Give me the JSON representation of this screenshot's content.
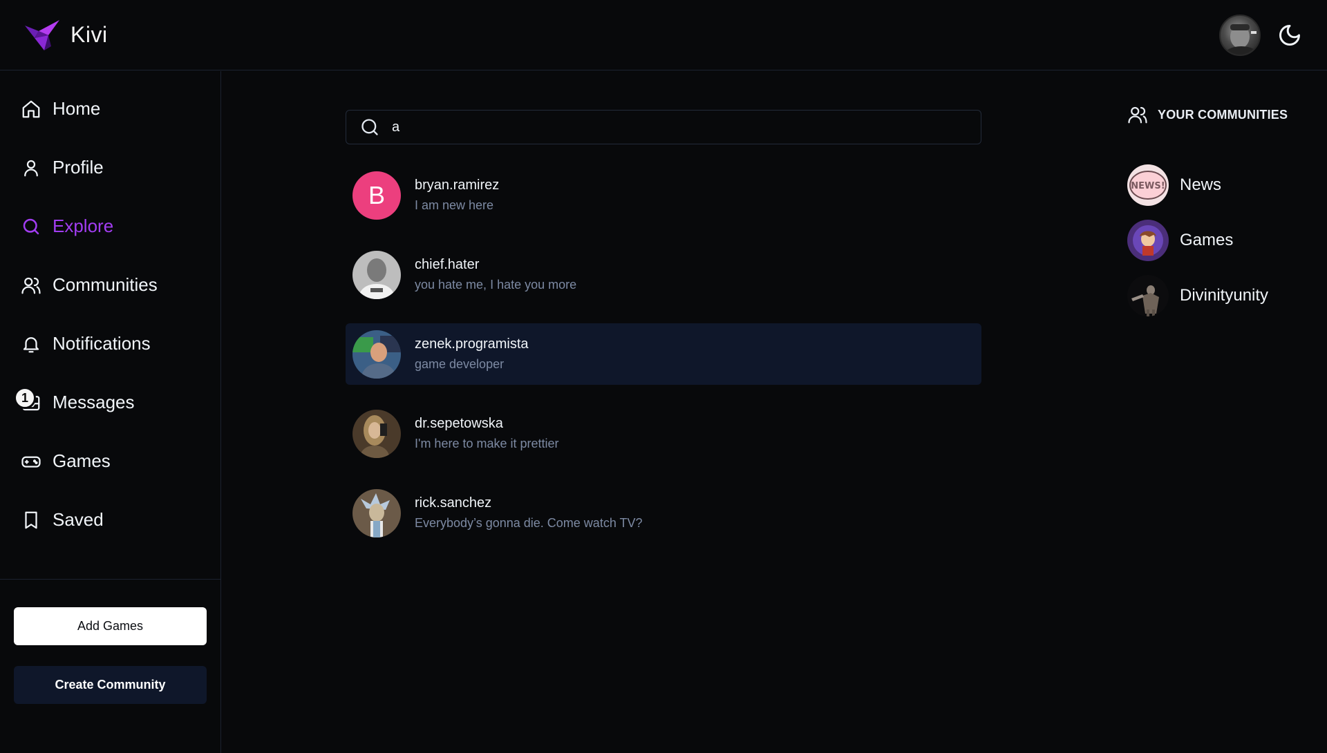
{
  "app": {
    "name": "Kivi"
  },
  "header": {
    "avatar_alt": "user avatar",
    "theme_toggle": "moon-icon"
  },
  "sidebar": {
    "items": [
      {
        "label": "Home",
        "icon": "home-icon",
        "active": false
      },
      {
        "label": "Profile",
        "icon": "user-icon",
        "active": false
      },
      {
        "label": "Explore",
        "icon": "search-icon",
        "active": true
      },
      {
        "label": "Communities",
        "icon": "users-icon",
        "active": false
      },
      {
        "label": "Notifications",
        "icon": "bell-icon",
        "active": false
      },
      {
        "label": "Messages",
        "icon": "inbox-icon",
        "active": false,
        "badge": "1"
      },
      {
        "label": "Games",
        "icon": "gamepad-icon",
        "active": false
      },
      {
        "label": "Saved",
        "icon": "bookmark-icon",
        "active": false
      }
    ],
    "add_games": "Add Games",
    "create_community": "Create Community"
  },
  "search": {
    "value": "a"
  },
  "results": [
    {
      "username": "bryan.ramirez",
      "bio": "I am new here",
      "initial": "B"
    },
    {
      "username": "chief.hater",
      "bio": "you hate me, I hate you more"
    },
    {
      "username": "zenek.programista",
      "bio": "game developer"
    },
    {
      "username": "dr.sepetowska",
      "bio": "I'm here to make it prettier"
    },
    {
      "username": "rick.sanchez",
      "bio": "Everybody’s gonna die. Come watch TV?"
    }
  ],
  "communities": {
    "heading": "YOUR COMMUNITIES",
    "items": [
      {
        "name": "News"
      },
      {
        "name": "Games"
      },
      {
        "name": "Divinityunity"
      }
    ]
  },
  "colors": {
    "accent": "#a23df2",
    "background": "#08090b",
    "highlight": "#0f172a",
    "avatar_letter_bg": "#ec3f7e"
  }
}
